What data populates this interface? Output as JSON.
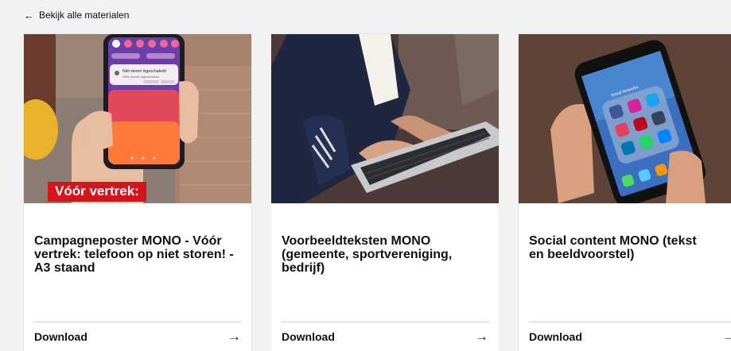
{
  "nav": {
    "back_label": "Bekijk alle materialen"
  },
  "cards": [
    {
      "badge": "Vóór vertrek:",
      "title": "Campagneposter MONO - Vóór vertrek: telefoon op niet storen! - A3 staand",
      "download_label": "Download",
      "phone_notification": {
        "title": "Niet storen ingeschakeld",
        "subtitle": "Stille modus ingeschakeld"
      }
    },
    {
      "title": "Voorbeeldteksten MONO (gemeente, sportvereniging, bedrijf)",
      "download_label": "Download"
    },
    {
      "title": "Social content MONO (tekst en beeldvoorstel)",
      "download_label": "Download",
      "phone_folder_label": "Social Networks"
    }
  ],
  "colors": {
    "accent_red": "#d8141b",
    "background": "#f2f2f2"
  }
}
